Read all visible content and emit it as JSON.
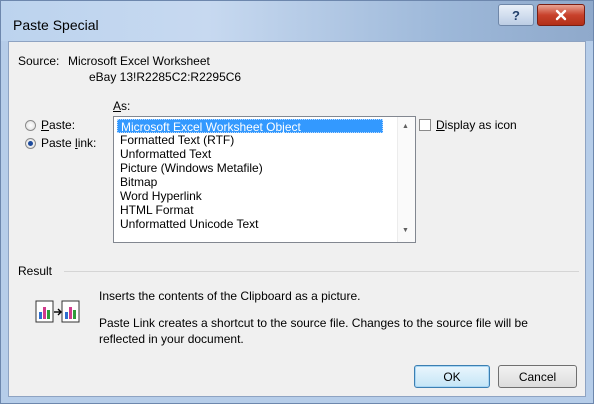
{
  "window": {
    "title": "Paste Special"
  },
  "source": {
    "label": "Source:",
    "name": "Microsoft Excel Worksheet",
    "range": "eBay 13!R2285C2:R2295C6"
  },
  "as_label": "As:",
  "options": {
    "paste": {
      "label": "Paste:",
      "selected": false
    },
    "paste_link": {
      "label": "Paste link:",
      "selected": true
    }
  },
  "as_list": {
    "items": [
      "Microsoft Excel Worksheet Object",
      "Formatted Text (RTF)",
      "Unformatted Text",
      "Picture (Windows Metafile)",
      "Bitmap",
      "Word Hyperlink",
      "HTML Format",
      "Unformatted Unicode Text"
    ],
    "selected_index": 0
  },
  "display_as_icon": {
    "label": "Display as icon",
    "checked": false
  },
  "result": {
    "label": "Result",
    "line1": "Inserts the contents of the Clipboard as a picture.",
    "line2": "Paste Link creates a shortcut to the source file. Changes to the source file will be",
    "line3": "reflected in your document."
  },
  "buttons": {
    "ok": "OK",
    "cancel": "Cancel"
  },
  "colors": {
    "selection": "#3399ff",
    "close": "#c8422c"
  }
}
